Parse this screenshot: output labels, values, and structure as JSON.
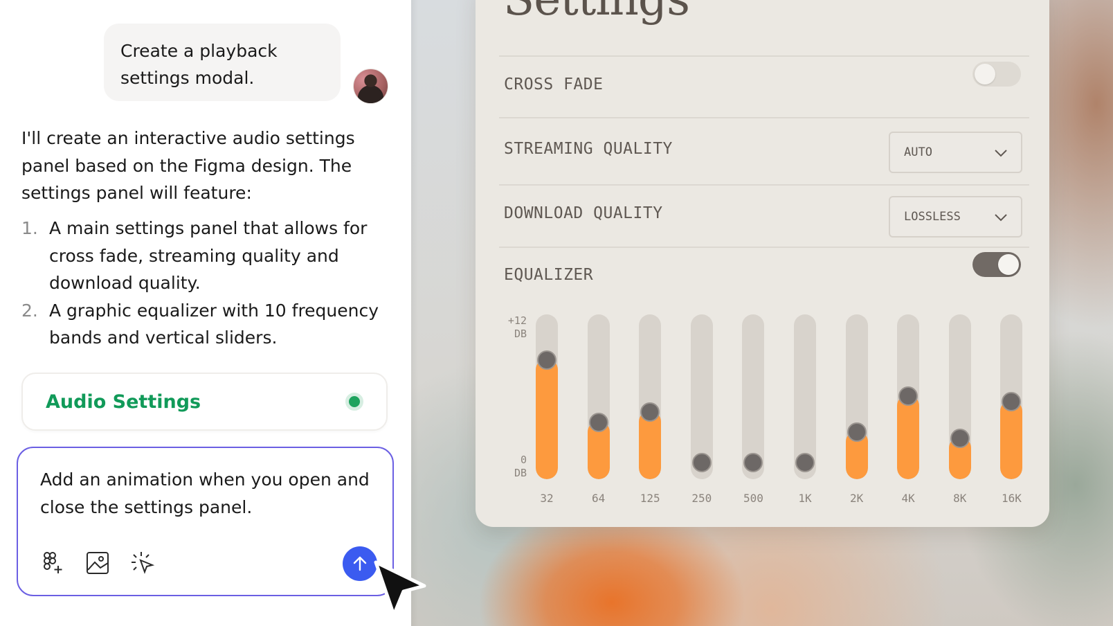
{
  "chat": {
    "user_message": "Create a playback settings modal.",
    "assistant_intro": "I'll create an interactive audio settings panel based on the Figma design. The settings panel will feature:",
    "assistant_points": [
      {
        "num": "1.",
        "text": "A main settings panel that allows for cross fade, streaming quality and download quality."
      },
      {
        "num": "2.",
        "text": "A graphic equalizer with 10 frequency bands and vertical sliders."
      }
    ],
    "artifact": {
      "title": "Audio Settings",
      "status_color": "#1ea35e"
    },
    "composer": {
      "text": "Add an animation when you open and close the settings panel.",
      "tools": [
        "figma-add-icon",
        "image-icon",
        "sparkle-select-icon"
      ],
      "send_icon": "arrow-up-icon"
    }
  },
  "settings": {
    "title": "Settings",
    "cross_fade": {
      "label": "CROSS FADE",
      "enabled": false
    },
    "streaming_quality": {
      "label": "STREAMING QUALITY",
      "value": "AUTO"
    },
    "download_quality": {
      "label": "DOWNLOAD QUALITY",
      "value": "LOSSLESS"
    },
    "equalizer": {
      "label": "EQUALIZER",
      "enabled": true,
      "axis_top": [
        "+12",
        "DB"
      ],
      "axis_bottom": [
        "0",
        "DB"
      ],
      "bands": [
        {
          "freq": "32",
          "level": 0.77
        },
        {
          "freq": "64",
          "level": 0.3
        },
        {
          "freq": "125",
          "level": 0.38
        },
        {
          "freq": "250",
          "level": 0.0
        },
        {
          "freq": "500",
          "level": 0.0
        },
        {
          "freq": "1K",
          "level": 0.0
        },
        {
          "freq": "2K",
          "level": 0.23
        },
        {
          "freq": "4K",
          "level": 0.5
        },
        {
          "freq": "8K",
          "level": 0.18
        },
        {
          "freq": "16K",
          "level": 0.46
        }
      ]
    }
  },
  "colors": {
    "accent_orange": "#fd9a3e",
    "composer_border": "#6b5fe3",
    "send_button": "#3b5bf0",
    "artifact_title": "#119a59"
  }
}
